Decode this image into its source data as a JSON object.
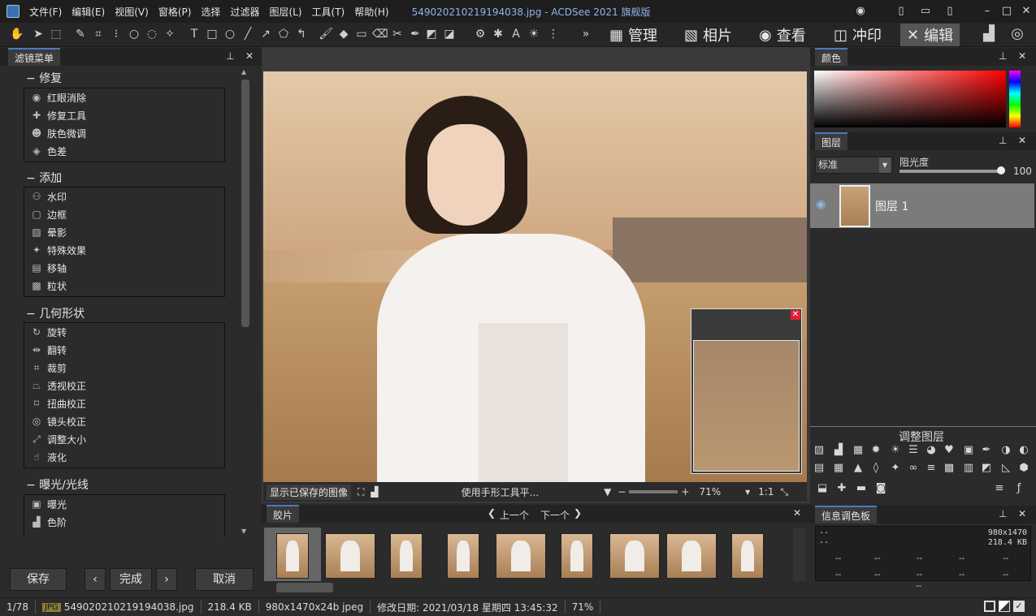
{
  "window": {
    "menus": [
      "文件(F)",
      "编辑(E)",
      "视图(V)",
      "窗格(P)",
      "选择",
      "过滤器",
      "图层(L)",
      "工具(T)",
      "帮助(H)"
    ],
    "title": "549020210219194038.jpg - ACDSee 2021 旗舰版"
  },
  "modes": [
    {
      "label": "管理",
      "icon": "grid-icon"
    },
    {
      "label": "相片",
      "icon": "photos-icon"
    },
    {
      "label": "查看",
      "icon": "eye-icon"
    },
    {
      "label": "冲印",
      "icon": "develop-icon"
    },
    {
      "label": "编辑",
      "icon": "edit-icon",
      "active": true
    }
  ],
  "filters_panel": {
    "tab": "滤镜菜单",
    "sections": [
      {
        "title": "修复",
        "items": [
          "红眼消除",
          "修复工具",
          "肤色微调",
          "色差"
        ]
      },
      {
        "title": "添加",
        "items": [
          "水印",
          "边框",
          "晕影",
          "特殊效果",
          "移轴",
          "粒状"
        ]
      },
      {
        "title": "几何形状",
        "items": [
          "旋转",
          "翻转",
          "裁剪",
          "透视校正",
          "扭曲校正",
          "镜头校正",
          "调整大小",
          "液化"
        ]
      },
      {
        "title": "曝光/光线",
        "items": [
          "曝光",
          "色阶"
        ]
      }
    ],
    "buttons": {
      "save": "保存",
      "done": "完成",
      "cancel": "取消"
    }
  },
  "viewer": {
    "show_saved": "显示已保存的图像",
    "hint": "使用手形工具平...",
    "zoom": "71%",
    "ratio": "1:1"
  },
  "filmstrip": {
    "tab": "胶片",
    "prev": "上一个",
    "next": "下一个",
    "thumb_count": 9
  },
  "color_panel": {
    "tab": "颜色"
  },
  "layers_panel": {
    "tab": "图层",
    "blend_mode": "标准",
    "opacity_label": "阻光度",
    "opacity_value": "100",
    "layer_name": "图层 1",
    "adjust_title": "调整图层"
  },
  "info_panel": {
    "tab": "信息调色板",
    "dims": "980x1470",
    "size": "218.4 KB",
    "dash": "--"
  },
  "status": {
    "index": "1/78",
    "format": "JPG",
    "filename": "549020210219194038.jpg",
    "filesize": "218.4 KB",
    "dims": "980x1470x24b jpeg",
    "modified": "修改日期: 2021/03/18 星期四 13:45:32",
    "zoom": "71%"
  },
  "colors": {
    "accent": "#4a7ac0",
    "title_text": "#8fb4e8"
  }
}
